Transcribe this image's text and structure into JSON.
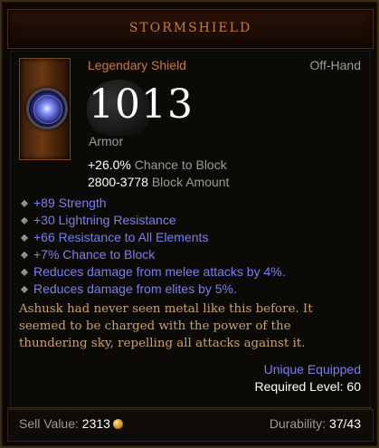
{
  "item": {
    "name": "STORMSHIELD",
    "type": "Legendary Shield",
    "slot": "Off-Hand",
    "armor": "1013",
    "armor_label": "Armor"
  },
  "primary_stats": [
    {
      "value": "+26.0%",
      "label": "Chance to Block"
    },
    {
      "value": "2800-3778",
      "label": "Block Amount"
    }
  ],
  "affixes": [
    "+89 Strength",
    "+30 Lightning Resistance",
    "+66 Resistance to All Elements",
    "+7% Chance to Block",
    "Reduces damage from melee attacks by 4%.",
    "Reduces damage from elites by 5%."
  ],
  "flavor_lines": [
    "Ashusk had never seen metal like this before. It",
    "seemed to be charged with the power of the",
    "thundering sky, repelling all attacks against it."
  ],
  "equipped": "Unique Equipped",
  "required_level": "Required Level: 60",
  "footer": {
    "sell_label": "Sell Value:",
    "sell_value": "2313",
    "durability_label": "Durability:",
    "durability_value": "37/43"
  },
  "colors": {
    "legendary": "#c8793a",
    "magic": "#7a7ef0",
    "flavor": "#c8a26a",
    "dim": "#9a9a9a"
  },
  "icons": {
    "item": "shield-icon",
    "affix_bullet": "diamond-bullet-icon",
    "currency": "gold-coin-icon"
  }
}
